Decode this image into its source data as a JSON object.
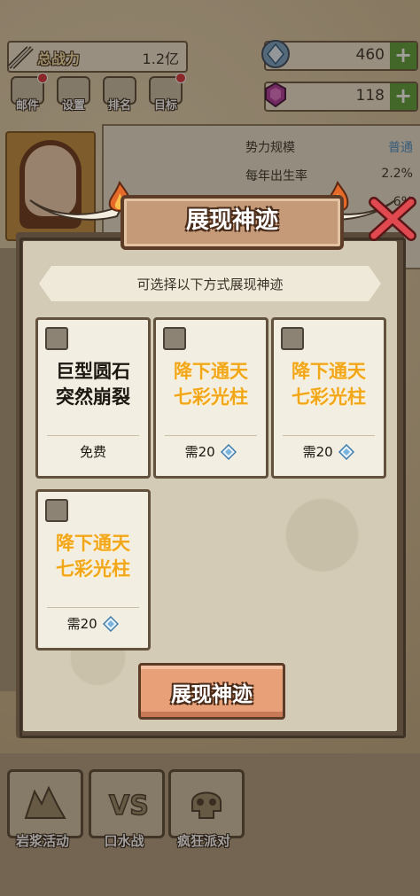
{
  "top": {
    "power_label": "总战力",
    "power_value": "1.2亿",
    "currency1_value": "460",
    "currency2_value": "118",
    "plus": "+"
  },
  "menus": [
    {
      "label": "邮件",
      "icon": "mail-icon",
      "badge": true
    },
    {
      "label": "设置",
      "icon": "gear-icon",
      "badge": false
    },
    {
      "label": "排名",
      "icon": "ranking-icon",
      "badge": false
    },
    {
      "label": "目标",
      "icon": "scroll-icon",
      "badge": true
    }
  ],
  "info": {
    "rows": [
      {
        "label": "势力规模",
        "value": "普通"
      },
      {
        "label": "每年出生率",
        "value": "2.2%"
      },
      {
        "label": "",
        "value": "6%"
      }
    ]
  },
  "dialog": {
    "title": "展现神迹",
    "subtitle": "可选择以下方式展现神迹",
    "confirm_label": "展现神迹",
    "options": [
      {
        "line1": "巨型圆石",
        "line2": "突然崩裂",
        "cost_label": "免费",
        "style": "black",
        "gem": false
      },
      {
        "line1": "降下通天",
        "line2": "七彩光柱",
        "cost_label": "需20",
        "style": "gold",
        "gem": true
      },
      {
        "line1": "降下通天",
        "line2": "七彩光柱",
        "cost_label": "需20",
        "style": "gold",
        "gem": true
      },
      {
        "line1": "降下通天",
        "line2": "七彩光柱",
        "cost_label": "需20",
        "style": "gold",
        "gem": true
      }
    ]
  },
  "activities": [
    {
      "label": "岩浆活动",
      "icon": "lava-icon"
    },
    {
      "label": "口水战",
      "icon": "versus-icon"
    },
    {
      "label": "疯狂派对",
      "icon": "skull-icon"
    }
  ],
  "colors": {
    "gold_text": "#f2a61a",
    "plus_green": "#5ea038",
    "info_blue": "#4a8ec7"
  }
}
